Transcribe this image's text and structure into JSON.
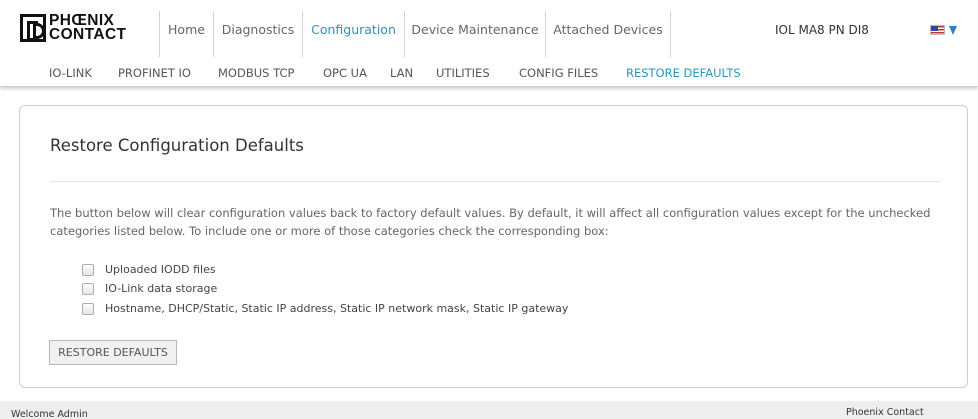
{
  "header": {
    "logo_line1": "PHŒNIX",
    "logo_line2": "CONTACT",
    "tabs": [
      {
        "label": "Home",
        "active": false
      },
      {
        "label": "Diagnostics",
        "active": false
      },
      {
        "label": "Configuration",
        "active": true
      },
      {
        "label": "Device Maintenance",
        "active": false
      },
      {
        "label": "Attached Devices",
        "active": false
      }
    ],
    "device_name": "IOL MA8 PN DI8",
    "language_icon": "us-flag-icon",
    "dropdown_icon": "triangle-down-icon"
  },
  "subnav": {
    "items": [
      {
        "label": "IO-LINK",
        "active": false
      },
      {
        "label": "PROFINET IO",
        "active": false
      },
      {
        "label": "MODBUS TCP",
        "active": false
      },
      {
        "label": "OPC UA",
        "active": false
      },
      {
        "label": "LAN",
        "active": false
      },
      {
        "label": "UTILITIES",
        "active": false
      },
      {
        "label": "CONFIG FILES",
        "active": false
      },
      {
        "label": "RESTORE DEFAULTS",
        "active": true
      }
    ]
  },
  "panel": {
    "title": "Restore Configuration Defaults",
    "description": "The button below will clear configuration values back to factory default values. By default, it will affect all configuration values except for the unchecked categories listed below. To include one or more of those categories check the corresponding box:",
    "options": [
      {
        "label": "Uploaded IODD files",
        "checked": false
      },
      {
        "label": "IO-Link data storage",
        "checked": false
      },
      {
        "label": "Hostname, DHCP/Static, Static IP address, Static IP network mask, Static IP gateway",
        "checked": false
      }
    ],
    "button_label": "RESTORE DEFAULTS"
  },
  "footer": {
    "welcome": "Welcome Admin",
    "company": "Phoenix Contact"
  },
  "colors": {
    "accent": "#2e94b9",
    "border": "#cfcfcf",
    "footer_bg": "#eeeeee"
  }
}
